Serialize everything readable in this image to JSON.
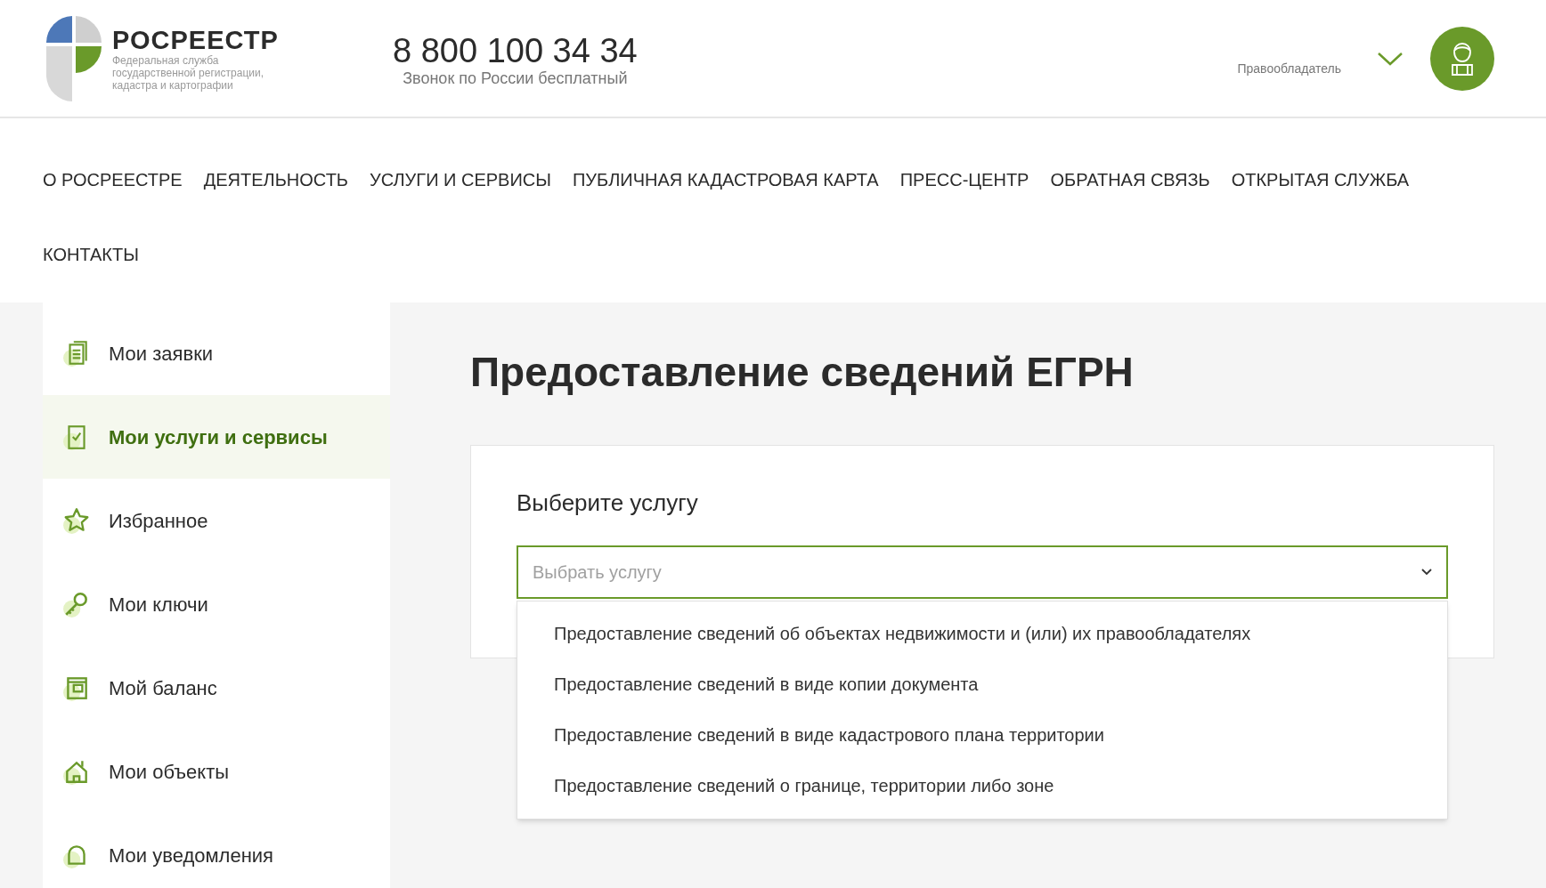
{
  "header": {
    "logo": {
      "name": "РОСРЕЕСТР",
      "subtitle": "Федеральная служба государственной регистрации, кадастра и картографии"
    },
    "phone": "8 800 100 34 34",
    "phone_note": "Звонок по России бесплатный",
    "role": "Правообладатель"
  },
  "nav": [
    {
      "label": "О РОСРЕЕСТРЕ"
    },
    {
      "label": "ДЕЯТЕЛЬНОСТЬ"
    },
    {
      "label": "УСЛУГИ И СЕРВИСЫ"
    },
    {
      "label": "ПУБЛИЧНАЯ КАДАСТРОВАЯ КАРТА"
    },
    {
      "label": "ПРЕСС-ЦЕНТР"
    },
    {
      "label": "ОБРАТНАЯ СВЯЗЬ"
    },
    {
      "label": "ОТКРЫТАЯ СЛУЖБА"
    },
    {
      "label": "КОНТАКТЫ"
    }
  ],
  "sidebar": {
    "items": [
      {
        "kind": "requests",
        "label": "Мои заявки",
        "selected": false
      },
      {
        "kind": "services",
        "label": "Мои услуги и сервисы",
        "selected": true
      },
      {
        "kind": "favorites",
        "label": "Избранное",
        "selected": false
      },
      {
        "kind": "keys",
        "label": "Мои ключи",
        "selected": false
      },
      {
        "kind": "balance",
        "label": "Мой баланс",
        "selected": false
      },
      {
        "kind": "objects",
        "label": "Мои объекты",
        "selected": false
      },
      {
        "kind": "notifications",
        "label": "Мои уведомления",
        "selected": false
      }
    ]
  },
  "main": {
    "title": "Предоставление сведений ЕГРН",
    "card": {
      "heading": "Выберите услугу",
      "select": {
        "placeholder": "Выбрать услугу",
        "expanded": true,
        "options": [
          {
            "label": "Предоставление сведений об объектах недвижимости и (или) их правообладателях"
          },
          {
            "label": "Предоставление сведений в виде копии документа"
          },
          {
            "label": "Предоставление сведений в виде кадастрового плана территории"
          },
          {
            "label": "Предоставление сведений о границе, территории либо зоне"
          }
        ]
      }
    }
  }
}
